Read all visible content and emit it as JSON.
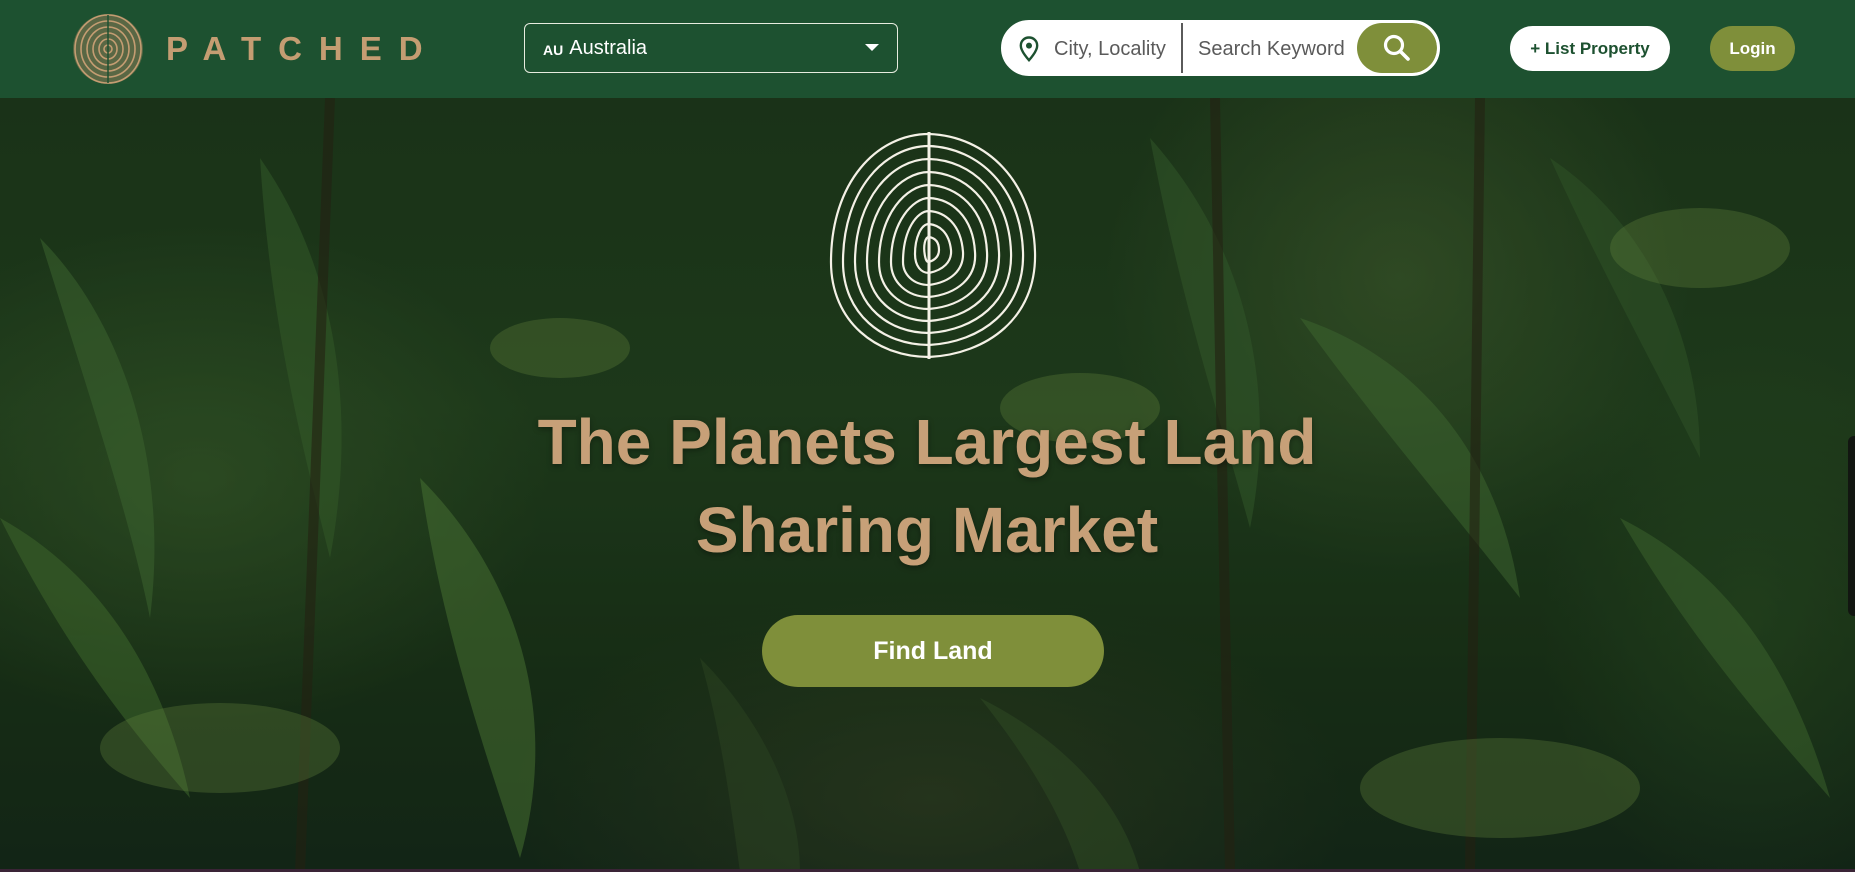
{
  "header": {
    "brand_name": "PATCHED",
    "country_select": {
      "code": "AU",
      "name": "Australia"
    },
    "search": {
      "city_placeholder": "City, Locality",
      "keyword_placeholder": "Search Keyword"
    },
    "list_property_label": "+ List Property",
    "login_label": "Login"
  },
  "hero": {
    "title_line1": "The Planets Largest Land",
    "title_line2": "Sharing Market",
    "cta_label": "Find Land"
  },
  "colors": {
    "header_bg": "#1d5130",
    "accent_olive": "#7f8f3a",
    "brand_tan": "#c49d72",
    "hero_title": "#c7a078"
  },
  "icons": [
    "patched-logo-icon",
    "location-pin-icon",
    "search-icon",
    "chevron-down-icon",
    "tree-ring-fingerprint-emblem"
  ]
}
